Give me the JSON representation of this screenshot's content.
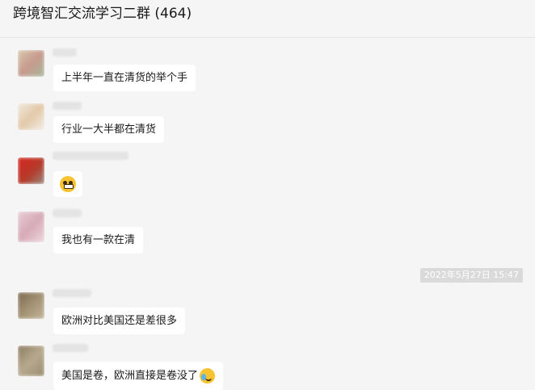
{
  "header": {
    "title": "跨境智汇交流学习二群 (464)"
  },
  "messages": [
    {
      "text": "上半年一直在清货的举个手"
    },
    {
      "text": "行业一大半都在清货"
    },
    {
      "emoji": "grinning-face-icon"
    },
    {
      "text": "我也有一款在清"
    },
    {
      "text": "欧洲对比美国还是差很多"
    },
    {
      "text": "美国是卷，欧洲直接是卷没了",
      "trailing_emoji": "laughing-tears-face-icon"
    }
  ],
  "timestamp": "2022年5月27日 15:47",
  "colors": {
    "background": "#f5f5f5",
    "bubble": "#ffffff",
    "timestamp_bg": "#dadada"
  }
}
